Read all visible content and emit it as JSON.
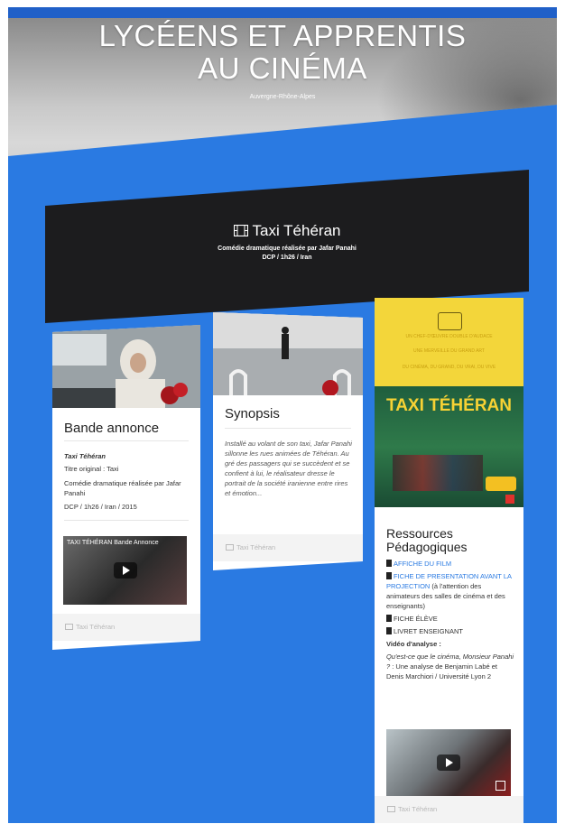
{
  "hero": {
    "title_line1": "LYCÉENS ET APPRENTIS",
    "title_line2": "AU CINÉMA",
    "subtitle": "Auvergne-Rhône-Alpes"
  },
  "film": {
    "icon": "film-icon",
    "title": "Taxi Téhéran",
    "subtitle1": "Comédie dramatique réalisée par Jafar Panahi",
    "subtitle2": "DCP / 1h26 / Iran"
  },
  "card_trailer": {
    "title": "Bande annonce",
    "film_name": "Taxi Téhéran",
    "original_title": "Titre original : Taxi",
    "genre": "Comédie dramatique réalisée par Jafar Panahi",
    "meta": "DCP / 1h26 / Iran / 2015",
    "video_label": "TAXI TÉHÉRAN Bande Annonce",
    "footer": "Taxi Téhéran"
  },
  "card_synopsis": {
    "title": "Synopsis",
    "text": "Installé au volant de son taxi, Jafar Panahi sillonne les rues animées de Téhéran. Au gré des passagers qui se succèdent et se confient à lui, le réalisateur dresse le portrait de la société iranienne entre rires et émotion...",
    "footer": "Taxi Téhéran"
  },
  "card_resources": {
    "poster": {
      "line1": "UN CHEF-D'ŒUVRE DOUBLE D'AUDACE",
      "line2": "UNE MERVEILLE DU GRAND ART",
      "line3": "DU CINÉMA, DU GRAND, DU VRAI, DU VIVE",
      "title": "TAXI TÉHÉRAN"
    },
    "title": "Ressources Pédagogiques",
    "items": [
      {
        "label": "AFFICHE DU FILM",
        "extra": ""
      },
      {
        "label": "FICHE DE PRESENTATION AVANT LA PROJECTION",
        "extra": " (à l'attention des animateurs des salles de cinéma et des enseignants)"
      },
      {
        "label": "FICHE ÉLÈVE",
        "extra": ""
      },
      {
        "label": "LIVRET ENSEIGNANT",
        "extra": ""
      }
    ],
    "video_heading": "Vidéo d'analyse :",
    "video_title": "Qu'est-ce que le cinéma, Monsieur Panahi ?",
    "video_desc": " : Une analyse de Benjamin Labé et Denis Marchiori / Université Lyon 2",
    "footer": "Taxi Téhéran"
  },
  "colors": {
    "page_bg": "#2a7ae2",
    "banner_bg": "#1c1c1e",
    "link": "#2a7ae2",
    "poster_yellow": "#f3d63a"
  }
}
